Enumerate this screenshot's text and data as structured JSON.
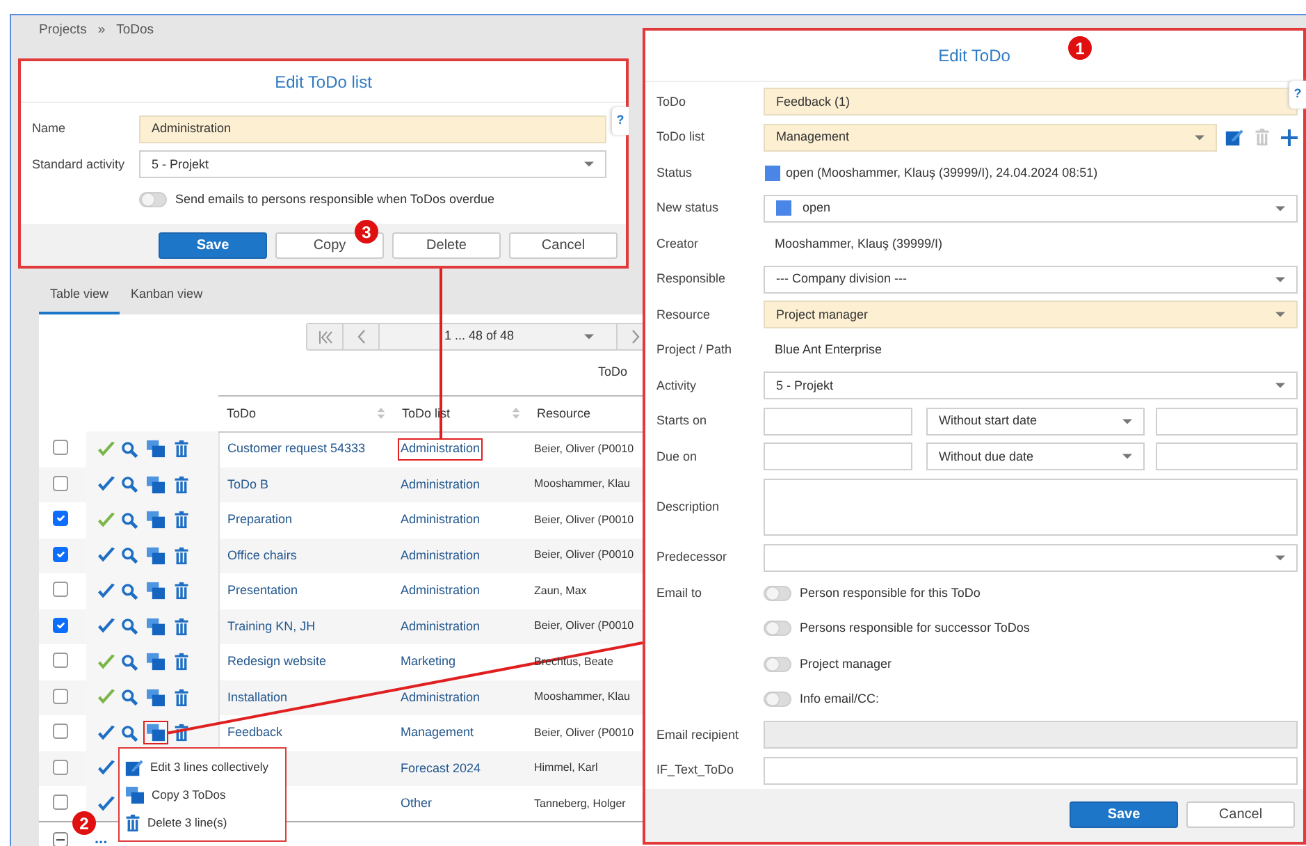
{
  "breadcrumb": {
    "items": [
      "Projects",
      "ToDos"
    ],
    "separator": "»"
  },
  "view_tabs": [
    {
      "label": "Table view",
      "selected": true
    },
    {
      "label": "Kanban view",
      "selected": false
    }
  ],
  "pager": {
    "range": "1 ... 48 of 48"
  },
  "group_header": "ToDo",
  "table": {
    "columns": [
      "ToDo",
      "ToDo list",
      "Resource"
    ],
    "rows": [
      {
        "checked": false,
        "actions": [
          {
            "kind": "check",
            "color": "#7ab648"
          },
          {
            "kind": "search"
          },
          {
            "kind": "copy",
            "highlighted": false
          },
          {
            "kind": "trash"
          }
        ],
        "todo": "Customer request 54333",
        "list": "Administration",
        "list_highlighted": true,
        "resource": "Beier, Oliver (P0010"
      },
      {
        "checked": false,
        "actions": [
          {
            "kind": "check",
            "color": "#1e6fc4"
          },
          {
            "kind": "search"
          },
          {
            "kind": "copy",
            "highlighted": false
          },
          {
            "kind": "trash"
          }
        ],
        "todo": "ToDo B",
        "list": "Administration",
        "list_highlighted": false,
        "resource": "Mooshammer, Klau"
      },
      {
        "checked": true,
        "actions": [
          {
            "kind": "check",
            "color": "#7ab648"
          },
          {
            "kind": "search"
          },
          {
            "kind": "copy",
            "highlighted": false
          },
          {
            "kind": "trash"
          }
        ],
        "todo": "Preparation",
        "list": "Administration",
        "list_highlighted": false,
        "resource": "Beier, Oliver (P0010"
      },
      {
        "checked": true,
        "actions": [
          {
            "kind": "check",
            "color": "#1e6fc4"
          },
          {
            "kind": "search"
          },
          {
            "kind": "copy",
            "highlighted": false
          },
          {
            "kind": "trash"
          }
        ],
        "todo": "Office chairs",
        "list": "Administration",
        "list_highlighted": false,
        "resource": "Beier, Oliver (P0010"
      },
      {
        "checked": false,
        "actions": [
          {
            "kind": "check",
            "color": "#1e6fc4"
          },
          {
            "kind": "search"
          },
          {
            "kind": "copy",
            "highlighted": false
          },
          {
            "kind": "trash"
          }
        ],
        "todo": "Presentation",
        "list": "Administration",
        "list_highlighted": false,
        "resource": "Zaun, Max"
      },
      {
        "checked": true,
        "actions": [
          {
            "kind": "check",
            "color": "#1e6fc4"
          },
          {
            "kind": "search"
          },
          {
            "kind": "copy",
            "highlighted": false
          },
          {
            "kind": "trash"
          }
        ],
        "todo": "Training KN, JH",
        "list": "Administration",
        "list_highlighted": false,
        "resource": "Beier, Oliver (P0010"
      },
      {
        "checked": false,
        "actions": [
          {
            "kind": "check",
            "color": "#7ab648"
          },
          {
            "kind": "search"
          },
          {
            "kind": "copy",
            "highlighted": false
          },
          {
            "kind": "trash"
          }
        ],
        "todo": "Redesign website",
        "list": "Marketing",
        "list_highlighted": false,
        "resource": "Brechtus, Beate"
      },
      {
        "checked": false,
        "actions": [
          {
            "kind": "check",
            "color": "#7ab648"
          },
          {
            "kind": "search"
          },
          {
            "kind": "copy",
            "highlighted": false
          },
          {
            "kind": "trash"
          }
        ],
        "todo": "Installation",
        "list": "Administration",
        "list_highlighted": false,
        "resource": "Mooshammer, Klau"
      },
      {
        "checked": false,
        "actions": [
          {
            "kind": "check",
            "color": "#1e6fc4"
          },
          {
            "kind": "search"
          },
          {
            "kind": "copy",
            "highlighted": true
          },
          {
            "kind": "trash"
          }
        ],
        "todo": "Feedback",
        "list": "Management",
        "list_highlighted": false,
        "resource": "Beier, Oliver (P0010"
      },
      {
        "checked": false,
        "actions": [
          {
            "kind": "check",
            "color": "#1e6fc4"
          }
        ],
        "list": "Forecast 2024",
        "list_highlighted": false,
        "resource": "Himmel, Karl"
      },
      {
        "checked": false,
        "actions": [
          {
            "kind": "check",
            "color": "#1e6fc4"
          }
        ],
        "list": "Other",
        "list_highlighted": false,
        "resource": "Tanneberg, Holger"
      }
    ],
    "select_all": {
      "indeterminate": true
    },
    "more": "..."
  },
  "row_menu": {
    "callout": "2",
    "items": [
      {
        "kind": "edit",
        "label": "Edit 3 lines collectively"
      },
      {
        "kind": "copy",
        "label": "Copy 3 ToDos"
      },
      {
        "kind": "delete",
        "label": "Delete 3 line(s)"
      }
    ]
  },
  "list_dialog": {
    "title": "Edit ToDo list",
    "callout": "3",
    "help": "?",
    "fields": [
      {
        "kind": "input",
        "label": "Name",
        "value": "Administration",
        "mandatory": true
      },
      {
        "kind": "select",
        "label": "Standard activity",
        "value": "5 - Projekt",
        "mandatory": false
      },
      {
        "kind": "toggle",
        "text": "Send emails to persons responsible when ToDos overdue",
        "on": false
      }
    ],
    "buttons": [
      {
        "label": "Save",
        "primary": true
      },
      {
        "label": "Copy",
        "primary": false
      },
      {
        "label": "Delete",
        "primary": false
      },
      {
        "label": "Cancel",
        "primary": false
      }
    ]
  },
  "todo_dialog": {
    "title": "Edit ToDo",
    "callout": "1",
    "help": "?",
    "fields": [
      {
        "kind": "input",
        "label": "ToDo",
        "value": "Feedback (1)",
        "mandatory": true,
        "disabled": false
      },
      {
        "kind": "select-tools",
        "label": "ToDo list",
        "value": "Management",
        "mandatory": true
      },
      {
        "kind": "status",
        "label": "Status",
        "value": "open (Mooshammer, Klauş (39999/I), 24.04.2024 08:51)",
        "color": "#4a86e8"
      },
      {
        "kind": "select",
        "label": "New status",
        "value": "open",
        "mandatory": false,
        "color": "#4a86e8"
      },
      {
        "kind": "static",
        "label": "Creator",
        "value": "Mooshammer, Klauş (39999/I)"
      },
      {
        "kind": "select",
        "label": "Responsible",
        "value": "--- Company division ---",
        "mandatory": false
      },
      {
        "kind": "select",
        "label": "Resource",
        "value": "Project manager",
        "mandatory": true
      },
      {
        "kind": "static",
        "label": "Project / Path",
        "value": "Blue Ant Enterprise"
      },
      {
        "kind": "select",
        "label": "Activity",
        "value": "5 - Projekt",
        "mandatory": false
      },
      {
        "kind": "dates",
        "label": "Starts on",
        "value": "Without start date"
      },
      {
        "kind": "dates",
        "label": "Due on",
        "value": "Without due date"
      },
      {
        "kind": "textarea",
        "label": "Description"
      },
      {
        "kind": "select",
        "label": "Predecessor",
        "mandatory": false
      },
      {
        "kind": "toggle",
        "label": "Email to",
        "text": "Person responsible for this ToDo",
        "on": false
      },
      {
        "kind": "toggle",
        "text": "Persons responsible for successor ToDos",
        "on": false
      },
      {
        "kind": "toggle",
        "text": "Project manager",
        "on": false
      },
      {
        "kind": "toggle",
        "text": "Info email/CC:",
        "on": false
      },
      {
        "kind": "input",
        "label": "Email recipient",
        "mandatory": false,
        "disabled": true
      },
      {
        "kind": "input",
        "label": "IF_Text_ToDo",
        "mandatory": false,
        "disabled": false
      }
    ],
    "buttons": [
      {
        "label": "Save",
        "primary": true
      },
      {
        "label": "Cancel",
        "primary": false
      }
    ]
  }
}
